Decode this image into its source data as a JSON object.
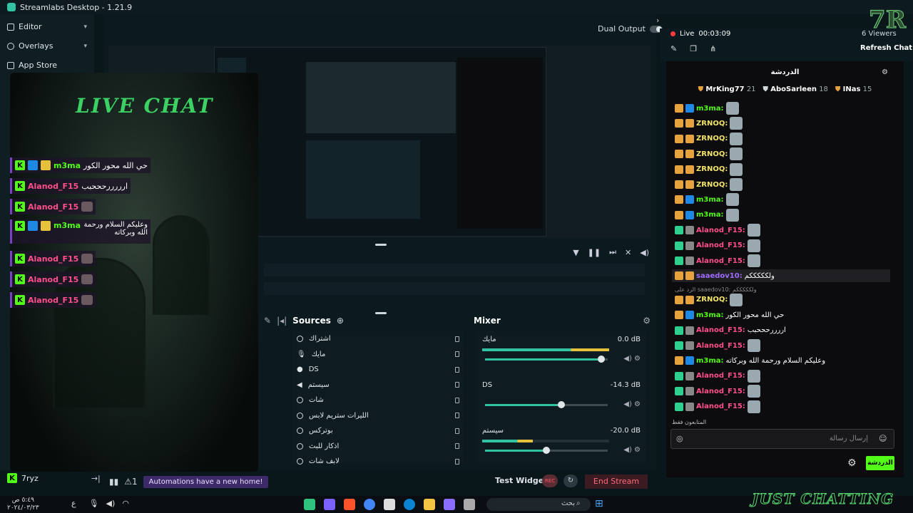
{
  "app": {
    "title": "Streamlabs Desktop - 1.21.9"
  },
  "sidebar": {
    "items": [
      {
        "label": "Editor"
      },
      {
        "label": "Overlays"
      },
      {
        "label": "App Store"
      }
    ],
    "user": "7ryz"
  },
  "top": {
    "dual_output_label": "Dual Output"
  },
  "sources": {
    "title": "Sources",
    "items": [
      "اشتراك",
      "مايك",
      "DS",
      "سيستم",
      "شات",
      "الليرات ستريم لابس",
      "بوترکس",
      "اذکار للبث",
      "لابف شات"
    ]
  },
  "mixer": {
    "title": "Mixer",
    "channels": [
      {
        "name": "مايك",
        "db": "0.0 dB",
        "level": 0.95
      },
      {
        "name": "DS",
        "db": "-14.3 dB",
        "level": 0.62
      },
      {
        "name": "سيستم",
        "db": "-20.0 dB",
        "level": 0.5
      }
    ]
  },
  "status": {
    "automation_note": "Automations have a new home!",
    "alert_count": "1",
    "test_widgets": "Test Widgets",
    "rec": "REC",
    "end_stream": "End Stream"
  },
  "overlay": {
    "title": "LIVE CHAT",
    "messages": [
      {
        "user": "m3ma",
        "text": "حي الله محور الكور",
        "color": "green"
      },
      {
        "user": "Alanod_F15",
        "text": "ارررررحححبب",
        "color": "pink"
      },
      {
        "user": "Alanod_F15",
        "text": "",
        "color": "pink"
      },
      {
        "user": "m3ma",
        "text": "وعليكم السلام ورحمة الله وبركاته",
        "color": "green"
      },
      {
        "user": "Alanod_F15",
        "text": "",
        "color": "pink"
      },
      {
        "user": "Alanod_F15",
        "text": "",
        "color": "pink"
      },
      {
        "user": "Alanod_F15",
        "text": "",
        "color": "pink"
      }
    ]
  },
  "chat": {
    "live_label": "Live",
    "live_time": "00:03:09",
    "viewers": "6 Viewers",
    "refresh": "Refresh Chat",
    "header": "الدردشة",
    "leaders": [
      {
        "name": "MrKing77",
        "count": "21"
      },
      {
        "name": "AboSarleen",
        "count": "18"
      },
      {
        "name": "INas",
        "count": "15"
      }
    ],
    "messages": [
      {
        "user": "m3ma:",
        "text": "",
        "color": "#53fc18"
      },
      {
        "user": "ZRNOQ:",
        "text": "",
        "color": "#f2e36b"
      },
      {
        "user": "ZRNOQ:",
        "text": "",
        "color": "#f2e36b"
      },
      {
        "user": "ZRNOQ:",
        "text": "",
        "color": "#f2e36b"
      },
      {
        "user": "ZRNOQ:",
        "text": "",
        "color": "#f2e36b"
      },
      {
        "user": "ZRNOQ:",
        "text": "",
        "color": "#f2e36b"
      },
      {
        "user": "m3ma:",
        "text": "",
        "color": "#53fc18"
      },
      {
        "user": "m3ma:",
        "text": "",
        "color": "#53fc18"
      },
      {
        "user": "Alanod_F15:",
        "text": "",
        "color": "#ff4f8b"
      },
      {
        "user": "Alanod_F15:",
        "text": "",
        "color": "#ff4f8b"
      },
      {
        "user": "Alanod_F15:",
        "text": "",
        "color": "#ff4f8b"
      },
      {
        "user": "saaedov10:",
        "text": "ولكككككم",
        "color": "#a06bff"
      },
      {
        "user": "ZRNOQ:",
        "text": "",
        "color": "#f2e36b"
      },
      {
        "user": "m3ma:",
        "text": "حي الله محور الكور",
        "color": "#53fc18"
      },
      {
        "user": "Alanod_F15:",
        "text": "اررررحححبب",
        "color": "#ff4f8b"
      },
      {
        "user": "Alanod_F15:",
        "text": "",
        "color": "#ff4f8b"
      },
      {
        "user": "m3ma:",
        "text": "وعليكم السلام ورحمة الله وبركاته",
        "color": "#53fc18"
      },
      {
        "user": "Alanod_F15:",
        "text": "",
        "color": "#ff4f8b"
      },
      {
        "user": "Alanod_F15:",
        "text": "",
        "color": "#ff4f8b"
      },
      {
        "user": "Alanod_F15:",
        "text": "",
        "color": "#ff4f8b"
      }
    ],
    "reply_hint": "الرد على saaedov10: ولكككككم",
    "followers_only": "المتابعون فقط",
    "input_placeholder": "إرسال رسالة",
    "send": "الدردشة"
  },
  "taskbar": {
    "search_placeholder": "بحث",
    "time": "٥:٤٩ ص",
    "date": "٢٠٢٤/٠٣/٢٣"
  },
  "brand": {
    "footer": "JUST CHATTING",
    "logo": "7R"
  }
}
